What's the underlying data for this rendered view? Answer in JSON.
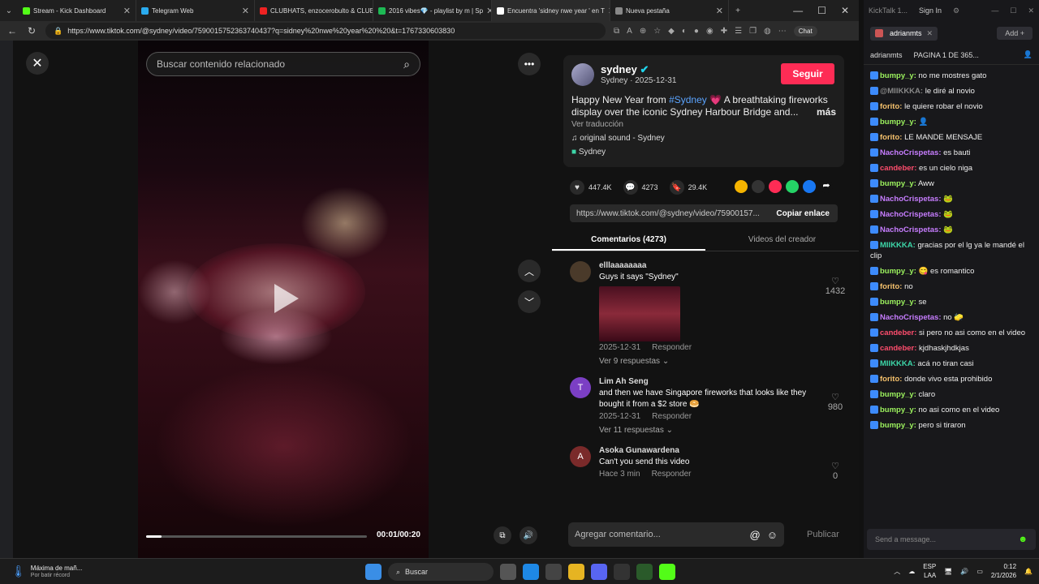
{
  "browser": {
    "tabs": [
      {
        "label": "Stream - Kick Dashboard",
        "color": "#53fc18"
      },
      {
        "label": "Telegram Web",
        "color": "#2aabee"
      },
      {
        "label": "CLUBHATS, enzocerobulto & CLUB",
        "color": "#e22"
      },
      {
        "label": "2016 vibes💎 - playlist by m | Sp",
        "color": "#1db954"
      },
      {
        "label": "Encuentra 'sidney nwe year ' en T",
        "color": "#fff"
      },
      {
        "label": "Nueva pestaña",
        "color": "#888"
      }
    ],
    "url": "https://www.tiktok.com/@sydney/video/7590015752363740437?q=sidney%20nwe%20year%20%20&t=1767330603830",
    "chat_label": "Chat"
  },
  "viewer": {
    "search_placeholder": "Buscar contenido relacionado",
    "time": "00:01/00:20",
    "progress": 0.07
  },
  "post": {
    "username": "sydney",
    "subline": "Sydney · 2025-12-31",
    "follow_label": "Seguir",
    "desc_pre": "Happy New Year from ",
    "desc_tag": "#Sydney",
    "desc_post": " 💗 A breathtaking fireworks display over the iconic Sydney Harbour Bridge and...",
    "more": "más",
    "translate": "Ver traducción",
    "sound": "original sound - Sydney",
    "location": "Sydney",
    "likes": "447.4K",
    "comments": "4273",
    "saves": "29.4K",
    "link": "https://www.tiktok.com/@sydney/video/75900157...",
    "copy_label": "Copiar enlace",
    "tab_comments": "Comentarios (4273)",
    "tab_creator": "Videos del creador",
    "add_comment": "Agregar comentario...",
    "publish": "Publicar"
  },
  "comments": [
    {
      "name": "elllaaaaaaaa",
      "text": "Guys it says \"Sydney\"",
      "date": "2025-12-31",
      "reply": "Responder",
      "replies": "Ver 9 respuestas",
      "likes": "1432",
      "avatar_color": "#4a3a2a",
      "initial": ""
    },
    {
      "name": "Lim Ah Seng",
      "text": "and then we have Singapore fireworks that looks like they bought it from a $2 store 🥯",
      "date": "2025-12-31",
      "reply": "Responder",
      "replies": "Ver 11 respuestas",
      "likes": "980",
      "avatar_color": "#7b3fc4",
      "initial": "T"
    },
    {
      "name": "Asoka Gunawardena",
      "text": "Can't you send this video",
      "date": "Hace 3 min",
      "reply": "Responder",
      "replies": "",
      "likes": "0",
      "avatar_color": "#7a2a2a",
      "initial": "A"
    }
  ],
  "kick": {
    "app": "KickTalk 1...",
    "signin": "Sign In",
    "channel": "adrianmts",
    "add": "Add",
    "info_user": "adrianmts",
    "info_page": "PAGINA 1 DE 365...",
    "messages": [
      {
        "user": "bumpy_y:",
        "color": "#9cf25e",
        "text": " no me mostres gato"
      },
      {
        "user": "@MIIKKKA:",
        "color": "#888",
        "text": " le diré al novio"
      },
      {
        "user": "forito:",
        "color": "#f5c16c",
        "text": " le quiere robar el novio"
      },
      {
        "user": "bumpy_y:",
        "color": "#9cf25e",
        "text": " 👤"
      },
      {
        "user": "forito:",
        "color": "#f5c16c",
        "text": " LE MANDE MENSAJE"
      },
      {
        "user": "NachoCrispetas:",
        "color": "#c77dff",
        "text": " es bauti"
      },
      {
        "user": "candeber:",
        "color": "#ff4d6d",
        "text": " es un cielo niga"
      },
      {
        "user": "bumpy_y:",
        "color": "#9cf25e",
        "text": " Aww"
      },
      {
        "user": "NachoCrispetas:",
        "color": "#c77dff",
        "text": " 🐸"
      },
      {
        "user": "NachoCrispetas:",
        "color": "#c77dff",
        "text": " 🐸"
      },
      {
        "user": "NachoCrispetas:",
        "color": "#c77dff",
        "text": " 🐸"
      },
      {
        "user": "MIIKKKA:",
        "color": "#3dd6a8",
        "text": " gracias por el lg ya le mandé el clip"
      },
      {
        "user": "bumpy_y:",
        "color": "#9cf25e",
        "text": " 😋 es romantico"
      },
      {
        "user": "forito:",
        "color": "#f5c16c",
        "text": " no"
      },
      {
        "user": "bumpy_y:",
        "color": "#9cf25e",
        "text": " se"
      },
      {
        "user": "NachoCrispetas:",
        "color": "#c77dff",
        "text": " no 🧽"
      },
      {
        "user": "candeber:",
        "color": "#ff4d6d",
        "text": " si pero no asi como en el video"
      },
      {
        "user": "candeber:",
        "color": "#ff4d6d",
        "text": " kjdhaskjhdkjas"
      },
      {
        "user": "MIIKKKA:",
        "color": "#3dd6a8",
        "text": " acá no tiran casi"
      },
      {
        "user": "forito:",
        "color": "#f5c16c",
        "text": " donde vivo esta prohibido"
      },
      {
        "user": "bumpy_y:",
        "color": "#9cf25e",
        "text": " claro"
      },
      {
        "user": "bumpy_y:",
        "color": "#9cf25e",
        "text": " no asi como en el video"
      },
      {
        "user": "bumpy_y:",
        "color": "#9cf25e",
        "text": " pero si tiraron"
      }
    ],
    "input_placeholder": "Send a message..."
  },
  "taskbar": {
    "weather_title": "Máxima de mañ...",
    "weather_sub": "Por batir récord",
    "search": "Buscar",
    "lang": "ESP",
    "lang2": "LAA",
    "time": "0:12",
    "date": "2/1/2026"
  }
}
